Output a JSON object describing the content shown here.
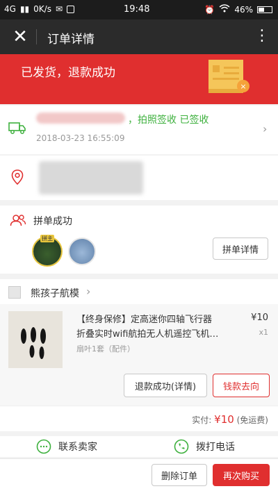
{
  "status_bar": {
    "network": "4G",
    "speed": "0K/s",
    "time": "19:48",
    "battery": "46%"
  },
  "header": {
    "title": "订单详情"
  },
  "banner": {
    "status_text": "已发货，退款成功"
  },
  "shipping": {
    "status": "，拍照签收 已签收",
    "time": "2018-03-23 16:55:09"
  },
  "group": {
    "title": "拼单成功",
    "host_tag": "拼主",
    "detail_button": "拼单详情"
  },
  "shop": {
    "name": "熊孩子航模"
  },
  "product": {
    "title": "【终身保修】定高迷你四轴飞行器折叠实时wifi航拍无人机遥控飞机…",
    "spec": "扇叶1套（配件）",
    "price": "¥10",
    "quantity": "x1",
    "refund_button": "退款成功(详情)",
    "money_button": "钱款去向"
  },
  "total": {
    "label": "实付:",
    "amount": "¥10",
    "note": "(免运费)"
  },
  "contact": {
    "seller_label": "联系卖家",
    "phone_label": "拨打电话"
  },
  "actions": {
    "delete_label": "删除订单",
    "rebuy_label": "再次购买"
  },
  "colors": {
    "accent": "#e02f2f",
    "success": "#3db03d",
    "nav_bg": "#2b2b2b"
  }
}
